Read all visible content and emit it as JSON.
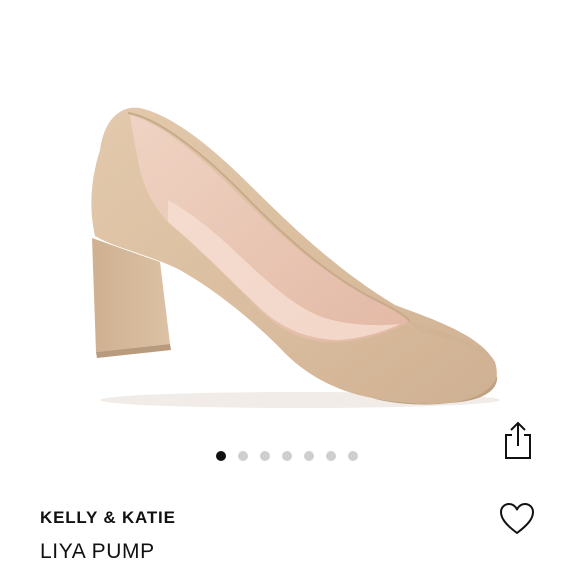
{
  "product": {
    "brand": "KELLY & KATIE",
    "name": "LIYA PUMP"
  },
  "carousel": {
    "total_images": 7,
    "active_index": 0
  },
  "actions": {
    "share_icon": "share-icon",
    "like_icon": "heart-outline-icon"
  },
  "colors": {
    "shoe_suede": "#dcc0a2",
    "shoe_lining": "#e9c7b5",
    "dot_active": "#111111",
    "dot_inactive": "#cfcfcf"
  }
}
